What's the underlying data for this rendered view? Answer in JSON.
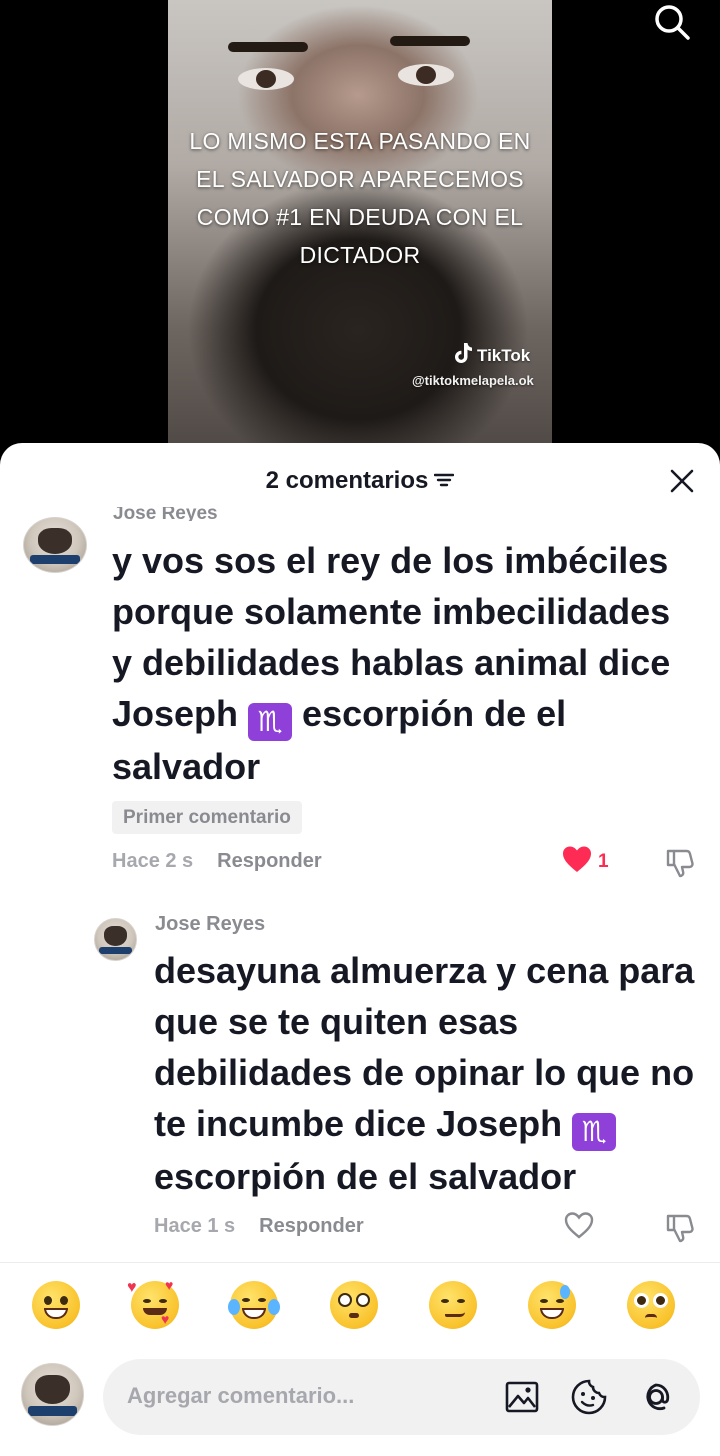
{
  "video": {
    "caption": "LO MISMO ESTA PASANDO EN EL SALVADOR APARECEMOS COMO #1 EN DEUDA CON EL DICTADOR",
    "watermark_brand": "TikTok",
    "watermark_handle": "@tiktokmelapela.ok"
  },
  "sheet": {
    "title": "2 comentarios",
    "close_icon": "close-icon",
    "filter_icon": "filter-icon"
  },
  "comments": [
    {
      "author": "Jose Reyes",
      "text_before_zodiac": "y vos sos el rey de los imbéciles porque solamente imbecilidades y debilidades hablas animal dice Joseph ",
      "zodiac": "♏",
      "text_after_zodiac": " escorpión de el salvador",
      "badge": "Primer comentario",
      "time": "Hace 2 s",
      "reply_label": "Responder",
      "likes": "1",
      "liked": true
    },
    {
      "author": "Jose Reyes",
      "text_before_zodiac": "desayuna almuerza y cena para que se te quiten esas debilidades de opinar lo que no te incumbe dice Joseph ",
      "zodiac": "♏",
      "text_after_zodiac": " escorpión de el salvador",
      "time": "Hace 1 s",
      "reply_label": "Responder",
      "liked": false
    }
  ],
  "emoji_bar": [
    "grinning-face",
    "smiling-face-with-hearts",
    "face-with-tears-of-joy",
    "flushed-face",
    "smirking-face",
    "grinning-face-with-sweat",
    "pleading-face"
  ],
  "composer": {
    "placeholder": "Agregar comentario...",
    "icons": [
      "image-icon",
      "sticker-icon",
      "mention-icon"
    ]
  },
  "colors": {
    "accent_like": "#fe2c55",
    "zodiac_bg": "#8e40d9",
    "text_primary": "#161823",
    "text_secondary": "#8a8b91"
  }
}
